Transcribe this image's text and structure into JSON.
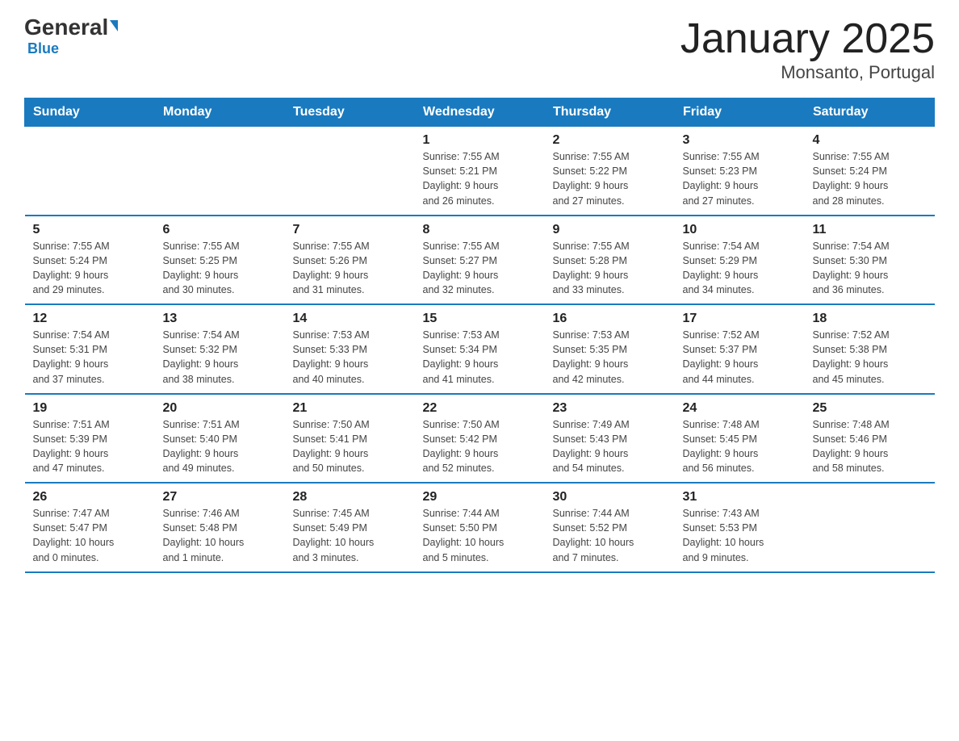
{
  "logo": {
    "name_part1": "General",
    "name_part2": "Blue"
  },
  "title": "January 2025",
  "subtitle": "Monsanto, Portugal",
  "days_of_week": [
    "Sunday",
    "Monday",
    "Tuesday",
    "Wednesday",
    "Thursday",
    "Friday",
    "Saturday"
  ],
  "weeks": [
    [
      {
        "day": "",
        "info": ""
      },
      {
        "day": "",
        "info": ""
      },
      {
        "day": "",
        "info": ""
      },
      {
        "day": "1",
        "info": "Sunrise: 7:55 AM\nSunset: 5:21 PM\nDaylight: 9 hours\nand 26 minutes."
      },
      {
        "day": "2",
        "info": "Sunrise: 7:55 AM\nSunset: 5:22 PM\nDaylight: 9 hours\nand 27 minutes."
      },
      {
        "day": "3",
        "info": "Sunrise: 7:55 AM\nSunset: 5:23 PM\nDaylight: 9 hours\nand 27 minutes."
      },
      {
        "day": "4",
        "info": "Sunrise: 7:55 AM\nSunset: 5:24 PM\nDaylight: 9 hours\nand 28 minutes."
      }
    ],
    [
      {
        "day": "5",
        "info": "Sunrise: 7:55 AM\nSunset: 5:24 PM\nDaylight: 9 hours\nand 29 minutes."
      },
      {
        "day": "6",
        "info": "Sunrise: 7:55 AM\nSunset: 5:25 PM\nDaylight: 9 hours\nand 30 minutes."
      },
      {
        "day": "7",
        "info": "Sunrise: 7:55 AM\nSunset: 5:26 PM\nDaylight: 9 hours\nand 31 minutes."
      },
      {
        "day": "8",
        "info": "Sunrise: 7:55 AM\nSunset: 5:27 PM\nDaylight: 9 hours\nand 32 minutes."
      },
      {
        "day": "9",
        "info": "Sunrise: 7:55 AM\nSunset: 5:28 PM\nDaylight: 9 hours\nand 33 minutes."
      },
      {
        "day": "10",
        "info": "Sunrise: 7:54 AM\nSunset: 5:29 PM\nDaylight: 9 hours\nand 34 minutes."
      },
      {
        "day": "11",
        "info": "Sunrise: 7:54 AM\nSunset: 5:30 PM\nDaylight: 9 hours\nand 36 minutes."
      }
    ],
    [
      {
        "day": "12",
        "info": "Sunrise: 7:54 AM\nSunset: 5:31 PM\nDaylight: 9 hours\nand 37 minutes."
      },
      {
        "day": "13",
        "info": "Sunrise: 7:54 AM\nSunset: 5:32 PM\nDaylight: 9 hours\nand 38 minutes."
      },
      {
        "day": "14",
        "info": "Sunrise: 7:53 AM\nSunset: 5:33 PM\nDaylight: 9 hours\nand 40 minutes."
      },
      {
        "day": "15",
        "info": "Sunrise: 7:53 AM\nSunset: 5:34 PM\nDaylight: 9 hours\nand 41 minutes."
      },
      {
        "day": "16",
        "info": "Sunrise: 7:53 AM\nSunset: 5:35 PM\nDaylight: 9 hours\nand 42 minutes."
      },
      {
        "day": "17",
        "info": "Sunrise: 7:52 AM\nSunset: 5:37 PM\nDaylight: 9 hours\nand 44 minutes."
      },
      {
        "day": "18",
        "info": "Sunrise: 7:52 AM\nSunset: 5:38 PM\nDaylight: 9 hours\nand 45 minutes."
      }
    ],
    [
      {
        "day": "19",
        "info": "Sunrise: 7:51 AM\nSunset: 5:39 PM\nDaylight: 9 hours\nand 47 minutes."
      },
      {
        "day": "20",
        "info": "Sunrise: 7:51 AM\nSunset: 5:40 PM\nDaylight: 9 hours\nand 49 minutes."
      },
      {
        "day": "21",
        "info": "Sunrise: 7:50 AM\nSunset: 5:41 PM\nDaylight: 9 hours\nand 50 minutes."
      },
      {
        "day": "22",
        "info": "Sunrise: 7:50 AM\nSunset: 5:42 PM\nDaylight: 9 hours\nand 52 minutes."
      },
      {
        "day": "23",
        "info": "Sunrise: 7:49 AM\nSunset: 5:43 PM\nDaylight: 9 hours\nand 54 minutes."
      },
      {
        "day": "24",
        "info": "Sunrise: 7:48 AM\nSunset: 5:45 PM\nDaylight: 9 hours\nand 56 minutes."
      },
      {
        "day": "25",
        "info": "Sunrise: 7:48 AM\nSunset: 5:46 PM\nDaylight: 9 hours\nand 58 minutes."
      }
    ],
    [
      {
        "day": "26",
        "info": "Sunrise: 7:47 AM\nSunset: 5:47 PM\nDaylight: 10 hours\nand 0 minutes."
      },
      {
        "day": "27",
        "info": "Sunrise: 7:46 AM\nSunset: 5:48 PM\nDaylight: 10 hours\nand 1 minute."
      },
      {
        "day": "28",
        "info": "Sunrise: 7:45 AM\nSunset: 5:49 PM\nDaylight: 10 hours\nand 3 minutes."
      },
      {
        "day": "29",
        "info": "Sunrise: 7:44 AM\nSunset: 5:50 PM\nDaylight: 10 hours\nand 5 minutes."
      },
      {
        "day": "30",
        "info": "Sunrise: 7:44 AM\nSunset: 5:52 PM\nDaylight: 10 hours\nand 7 minutes."
      },
      {
        "day": "31",
        "info": "Sunrise: 7:43 AM\nSunset: 5:53 PM\nDaylight: 10 hours\nand 9 minutes."
      },
      {
        "day": "",
        "info": ""
      }
    ]
  ]
}
